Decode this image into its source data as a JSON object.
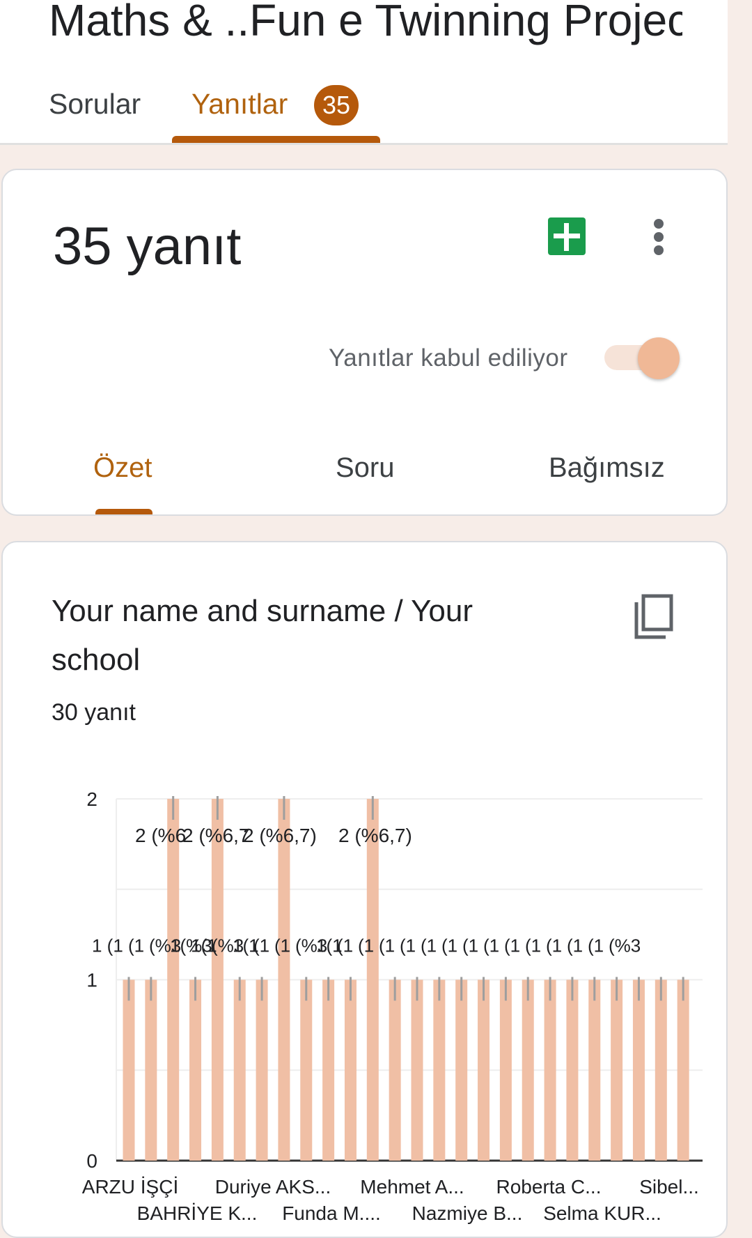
{
  "header": {
    "form_title": "Maths & ..Fun e Twinning Project",
    "tabs": [
      {
        "label": "Sorular",
        "active": false
      },
      {
        "label": "Yanıtlar",
        "active": true,
        "badge": "35"
      }
    ]
  },
  "summary": {
    "response_count": "35 yanıt",
    "accepting_label": "Yanıtlar kabul ediliyor",
    "accepting": true,
    "subtabs": [
      {
        "label": "Özet",
        "active": true
      },
      {
        "label": "Soru",
        "active": false
      },
      {
        "label": "Bağımsız",
        "active": false
      }
    ]
  },
  "question": {
    "title": "Your name and surname / Your school",
    "response_count": "30 yanıt"
  },
  "colors": {
    "accent": "#b5590b",
    "bar": "#f0bfa5",
    "sheets_green": "#1a9c4c"
  },
  "icons": [
    "sheets-icon",
    "more-vert-icon",
    "copy-icon"
  ],
  "chart_data": {
    "type": "bar",
    "ylim": [
      0,
      2
    ],
    "yticks": [
      0,
      1,
      2
    ],
    "grid": true,
    "values": [
      1,
      1,
      2,
      1,
      2,
      1,
      1,
      2,
      1,
      1,
      1,
      2,
      1,
      1,
      1,
      1,
      1,
      1,
      1,
      1,
      1,
      1,
      1,
      1,
      1,
      1
    ],
    "data_labels": [
      "1 (1",
      "(1",
      "(%3",
      "1(%3",
      "1(1",
      "(%3",
      "1(1",
      "(1",
      "(1",
      "(%3",
      "1(1",
      "(1",
      "(1",
      "(1",
      "(1",
      "(1",
      "(1",
      "(1",
      "(1",
      "(1",
      "(1",
      "(1",
      "(1",
      "(1",
      "(%3"
    ],
    "top_labels": [
      "2 (%6",
      "2 (%6,7",
      "2 (%6,7)",
      "2 (%6,7)"
    ],
    "x_tick_labels_row1": [
      "ARZU İŞÇİ",
      "Duriye AKS...",
      "Mehmet A...",
      "Roberta C...",
      "Sibel..."
    ],
    "x_tick_labels_row2": [
      "BAHRİYE K...",
      "Funda M....",
      "Nazmiye B...",
      "Selma KUR..."
    ]
  }
}
